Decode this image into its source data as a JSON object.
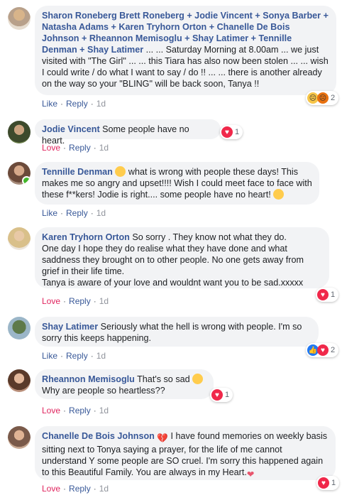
{
  "comments": [
    {
      "author": "Sharon Roneberg",
      "tagged": "Brett Roneberg + Jodie Vincent + Sonya Barber + Natasha Adams + Karen Tryhorn Orton + Chanelle De Bois Johnson + Rheannon Memisoglu + Shay Latimer + Tennille Denman + Shay Latimer",
      "text": " ... ... Saturday Morning at 8.00am ... we just visited with \"The Girl\" ... ... this Tiara has also now been stolen ... ... wish I could write / do what I want to say / do !! ... ... there is another already on the way so your \"BLING\" will be back soon, Tanya !!",
      "action": "Like",
      "reply": "Reply",
      "time": "1d",
      "reaction_count": "2",
      "reactions": [
        "sad",
        "angry"
      ]
    },
    {
      "author": "Jodie Vincent",
      "text": " Some people have no heart.",
      "action": "Love",
      "reply": "Reply",
      "time": "1d",
      "reaction_count": "1",
      "reactions": [
        "heart"
      ]
    },
    {
      "author": "Tennille Denman",
      "text_a": " what is wrong with people these days! This makes me so angry and upset!!!! Wish I could meet face to face with these f**kers! Jodie is right.... some people have no heart! ",
      "action": "Like",
      "reply": "Reply",
      "time": "1d"
    },
    {
      "author": "Karen Tryhorn Orton",
      "text": " So sorry . They know not what they do.\nOne day I hope they do realise what they have done and what saddness they brought on to other people. No one gets away from grief in their life time.\nTanya is aware of your love and wouldnt want you to be sad.xxxxx",
      "action": "Love",
      "reply": "Reply",
      "time": "1d",
      "reaction_count": "1",
      "reactions": [
        "heart"
      ]
    },
    {
      "author": "Shay Latimer",
      "text": " Seriously what the hell is wrong with people. I'm so sorry this keeps happening.",
      "action": "Like",
      "reply": "Reply",
      "time": "1d",
      "reaction_count": "2",
      "reactions": [
        "like",
        "heart"
      ]
    },
    {
      "author": "Rheannon Memisoglu",
      "text": " That's so sad ",
      "text_b": "Why are people so heartless??",
      "action": "Love",
      "reply": "Reply",
      "time": "1d",
      "reaction_count": "1",
      "reactions": [
        "heart"
      ]
    },
    {
      "author": "Chanelle De Bois Johnson",
      "text": " I have found memories on weekly basis sitting next to Tonya saying a prayer, for the life of me cannot understand Y some people are SO cruel. I'm sorry this happened again to this Beautiful Family. You are always in my Heart.",
      "action": "Love",
      "reply": "Reply",
      "time": "1d",
      "reaction_count": "1",
      "reactions": [
        "heart"
      ]
    }
  ],
  "colors": {
    "name": "#385898",
    "love": "#e0245e",
    "bubble": "#f2f3f5",
    "online": "#42b72a"
  }
}
